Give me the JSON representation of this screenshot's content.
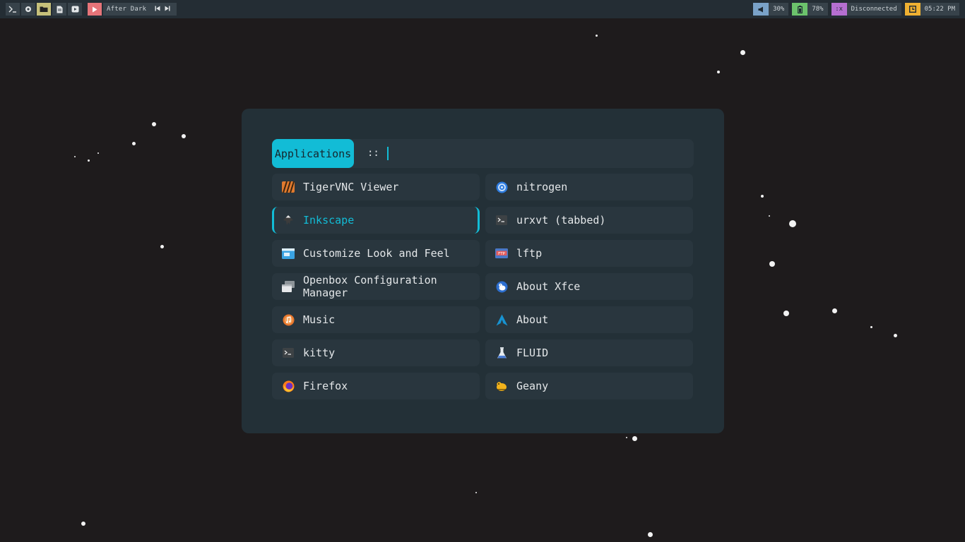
{
  "topbar": {
    "launcher_icons": [
      "terminal-icon",
      "web-icon",
      "folder-icon",
      "text-editor-icon",
      "media-player-icon"
    ],
    "media": {
      "play_icon": "play-icon",
      "title": "After Dark",
      "prev_icon": "skip-previous-icon",
      "next_icon": "skip-next-icon"
    },
    "volume": {
      "icon": "volume-icon",
      "value": "30%"
    },
    "battery": {
      "icon": "battery-icon",
      "value": "78%"
    },
    "network": {
      "icon": "network-icon",
      "icon_text": ":x",
      "value": "Disconnected"
    },
    "clock": {
      "icon": "clock-icon",
      "value": "05:22 PM"
    },
    "colors": {
      "volume": "#7aa2c8",
      "battery": "#6cc36c",
      "network": "#b56fd1",
      "clock": "#efb132",
      "media": "#e67479"
    }
  },
  "launcher": {
    "mode_label": "Applications",
    "prompt": "::",
    "accent": "#12bcd6",
    "items": [
      {
        "label": "TigerVNC Viewer",
        "icon": "tigervnc-icon",
        "selected": false
      },
      {
        "label": "nitrogen",
        "icon": "nitrogen-icon",
        "selected": false
      },
      {
        "label": "Inkscape",
        "icon": "inkscape-icon",
        "selected": true
      },
      {
        "label": "urxvt (tabbed)",
        "icon": "terminal-icon",
        "selected": false
      },
      {
        "label": "Customize Look and Feel",
        "icon": "appearance-icon",
        "selected": false
      },
      {
        "label": "lftp",
        "icon": "ftp-icon",
        "selected": false
      },
      {
        "label": "Openbox Configuration Manager",
        "icon": "window-manager-icon",
        "selected": false
      },
      {
        "label": "About Xfce",
        "icon": "xfce-icon",
        "selected": false
      },
      {
        "label": "Music",
        "icon": "music-icon",
        "selected": false
      },
      {
        "label": "About",
        "icon": "arch-icon",
        "selected": false
      },
      {
        "label": "kitty",
        "icon": "terminal-icon",
        "selected": false
      },
      {
        "label": "FLUID",
        "icon": "flask-icon",
        "selected": false
      },
      {
        "label": "Firefox",
        "icon": "firefox-icon",
        "selected": false
      },
      {
        "label": "Geany",
        "icon": "geany-icon",
        "selected": false
      }
    ]
  }
}
